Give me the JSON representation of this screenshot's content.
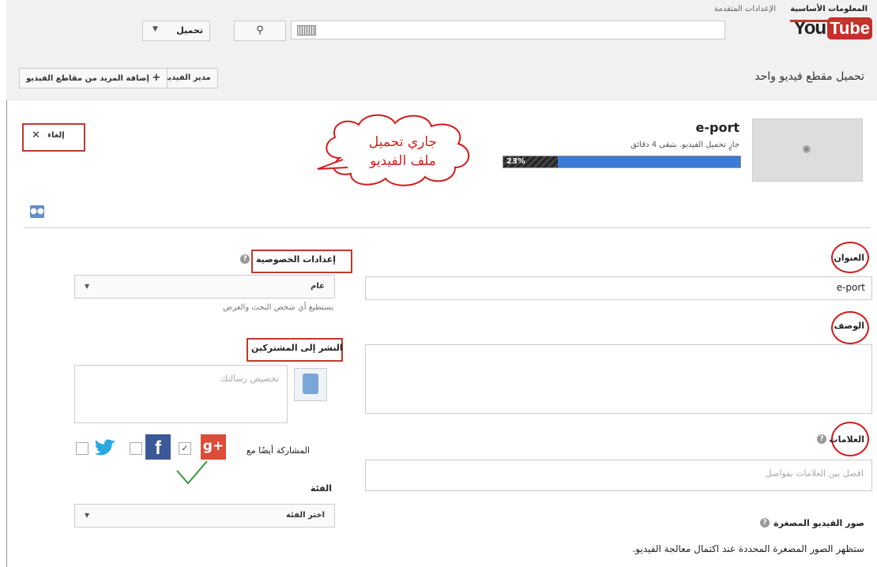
{
  "header": {
    "logo_you": "You",
    "logo_tube": "Tube",
    "search_placeholder": "",
    "upload_label": "تحميل"
  },
  "subheader": {
    "title": "تحميل مقطع فيديو واحد",
    "video_manager": "مدير الفيديو",
    "add_more": "إضافة المزيد من مقاطع الفيديو"
  },
  "upload": {
    "cancel_label": "إلغاء",
    "video_title": "e-port",
    "status": "جارٍ تحميل الفيديو. يتبقى 4 دقائق",
    "progress_percent": 23,
    "progress_label": "23%",
    "callout_line1": "جاري تحميل",
    "callout_line2": "ملف الفيديو"
  },
  "tabs": [
    {
      "label": "المعلومات الأساسية",
      "active": true
    },
    {
      "label": "الإعدادات المتقدمة",
      "active": false
    }
  ],
  "form": {
    "title_label": "العنوان",
    "title_value": "e-port",
    "description_label": "الوصف",
    "tags_label": "العلامات",
    "tags_placeholder": "افصل بين العلامات بفواصل",
    "thumbnails_label": "صور الفيديو المصغرة",
    "thumbnails_note": "ستظهر الصور المصغرة المحددة عند اكتمال معالجة الفيديو."
  },
  "privacy": {
    "label": "إعدادات الخصوصية",
    "selected": "عام",
    "hint": "يستطيع أي شخص البحث والعرض"
  },
  "subscribers": {
    "label": "النشر إلى المشتركين",
    "message_placeholder": "تخصيص رسالتك",
    "share_also": "المشاركة أيضًا مع",
    "gplus": "g+",
    "facebook": "f"
  },
  "category": {
    "label": "الفئة",
    "selected": "اختر الفئة"
  },
  "colors": {
    "youtube_red": "#c4302b",
    "annotation_red": "#d21c1c",
    "progress_blue": "#3a7bd5"
  }
}
